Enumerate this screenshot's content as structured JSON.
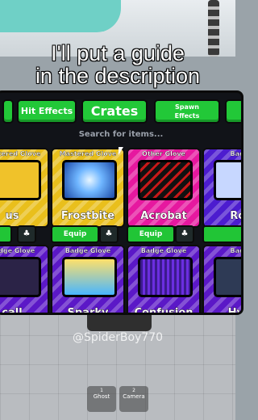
{
  "caption": [
    "I'll put a guide",
    "in the description"
  ],
  "tabs": [
    "Hit Effects",
    "Crates",
    "Spawn",
    "Effects"
  ],
  "search_placeholder": "Search for items...",
  "row1": [
    {
      "type": "Mastered Glove",
      "name": "us"
    },
    {
      "type": "Mastered Glove",
      "name": "Frostbite"
    },
    {
      "type": "Other Glove",
      "name": "Acrobat"
    },
    {
      "type": "Badg",
      "name": "Roj"
    }
  ],
  "row2": [
    {
      "type": "Badge Glove",
      "name": "call"
    },
    {
      "type": "Badge Glove",
      "name": "Sparky"
    },
    {
      "type": "Badge Glove",
      "name": "Confusion"
    },
    {
      "type": "Badg",
      "name": "Hyb"
    }
  ],
  "equip_label": "Equip",
  "watermark": "@SpiderBoy770",
  "hud": [
    {
      "key": "1",
      "label": "Ghost"
    },
    {
      "key": "2",
      "label": "Camera"
    }
  ]
}
